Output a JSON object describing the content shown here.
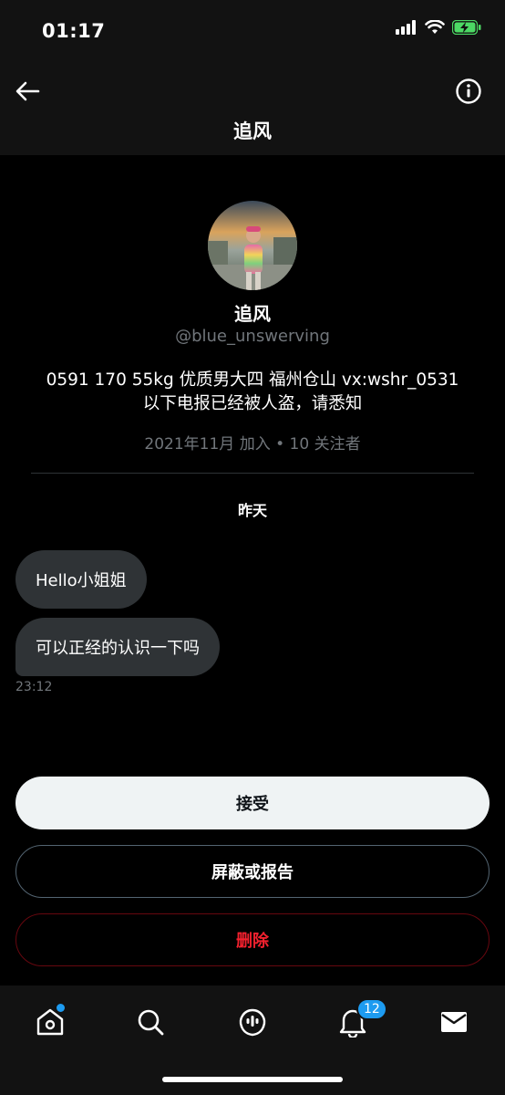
{
  "status_bar": {
    "time": "01:17",
    "icons": [
      "signal-icon",
      "wifi-icon",
      "battery-charging-icon"
    ],
    "battery_color": "#4cd964"
  },
  "header": {
    "title": "追风",
    "back_icon": "back-arrow-icon",
    "info_icon": "info-icon"
  },
  "profile": {
    "name": "追风",
    "handle": "@blue_unswerving",
    "bio_line1": "0591 170 55kg 优质男大四  福州仓山   vx:wshr_0531",
    "bio_line2": "以下电报已经被人盗，请悉知",
    "meta": "2021年11月 加入 • 10 关注者"
  },
  "conversation": {
    "date_separator": "昨天",
    "messages": [
      {
        "text": "Hello小姐姐"
      },
      {
        "text": "可以正经的认识一下吗"
      }
    ],
    "last_time": "23:12"
  },
  "actions": {
    "accept_label": "接受",
    "block_label": "屏蔽或报告",
    "delete_label": "删除"
  },
  "tab_bar": {
    "items": [
      "home-icon",
      "search-icon",
      "spaces-icon",
      "notifications-icon",
      "messages-icon"
    ],
    "notifications_badge": "12"
  },
  "colors": {
    "accent": "#1d9bf0",
    "danger": "#f4212e",
    "bubble": "#2f3336",
    "secondary_text": "#71767b"
  }
}
